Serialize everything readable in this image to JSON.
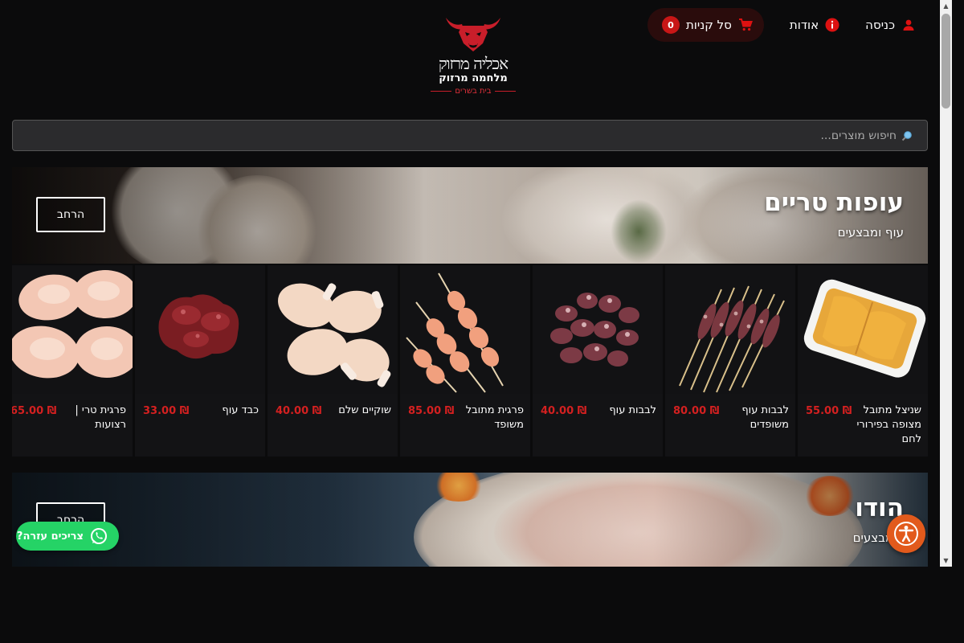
{
  "header": {
    "nav": {
      "login_label": "כניסה",
      "about_label": "אודות",
      "cart_label": "סל קניות",
      "cart_count": "0"
    },
    "logo": {
      "script_text": "אכליה מרזוק",
      "subtitle": "מלחמה מרזוק",
      "tagline": "בית בשרים"
    }
  },
  "search": {
    "placeholder": "חיפוש מוצרים..."
  },
  "categories": [
    {
      "title": "עופות טריים",
      "subtitle": "עוף ומבצעים",
      "expand_label": "הרחב"
    },
    {
      "title": "הודו",
      "subtitle": "ו ומבצעים",
      "expand_label": "הרחב"
    }
  ],
  "products": [
    {
      "name": "שניצל מתובל מצופה בפירורי לחם",
      "price": "55.00 ₪"
    },
    {
      "name": "לבבות עוף משופדים",
      "price": "80.00 ₪"
    },
    {
      "name": "לבבות עוף",
      "price": "40.00 ₪"
    },
    {
      "name": "פרגית מתובל משופד",
      "price": "85.00 ₪"
    },
    {
      "name": "שוקיים שלם",
      "price": "40.00 ₪"
    },
    {
      "name": "כבד עוף",
      "price": "33.00 ₪"
    },
    {
      "name": "פרגית טרי | רצועות",
      "price": "65.00 ₪"
    }
  ],
  "widgets": {
    "whatsapp_label": "צריכים עזרה?"
  },
  "colors": {
    "accent_red": "#c81616",
    "price_red": "#d42020",
    "whatsapp_green": "#25d366",
    "accessibility_orange": "#e25a1c"
  }
}
